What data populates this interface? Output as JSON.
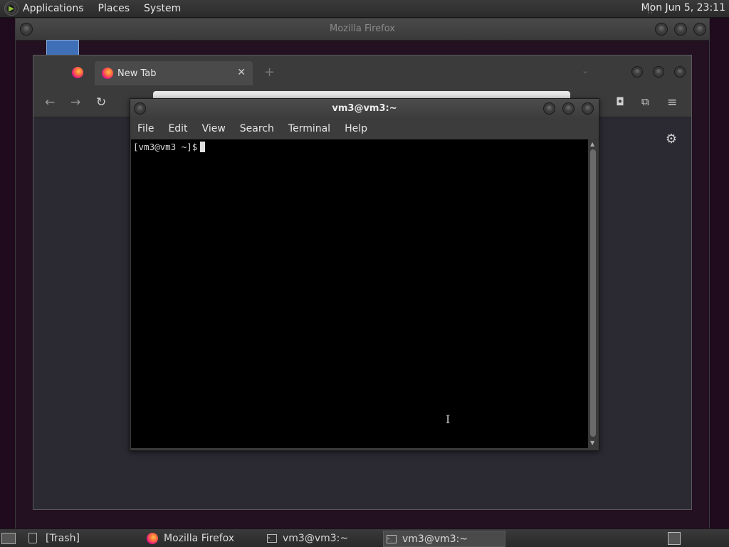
{
  "top_panel": {
    "menus": [
      "Applications",
      "Places",
      "System"
    ],
    "clock": "Mon Jun  5, 23:11"
  },
  "firefox": {
    "outer_title": "Mozilla Firefox",
    "tab_title": "New Tab",
    "tab_close_glyph": "✕",
    "new_tab_glyph": "+",
    "tab_list_glyph": "⌄"
  },
  "terminal": {
    "title": "vm3@vm3:~",
    "menus": [
      "File",
      "Edit",
      "View",
      "Search",
      "Terminal",
      "Help"
    ],
    "prompt": "[vm3@vm3 ~]$"
  },
  "taskbar": {
    "items": [
      {
        "label": "[Trash]"
      },
      {
        "label": "Mozilla Firefox"
      },
      {
        "label": "vm3@vm3:~"
      },
      {
        "label": "vm3@vm3:~"
      }
    ]
  }
}
